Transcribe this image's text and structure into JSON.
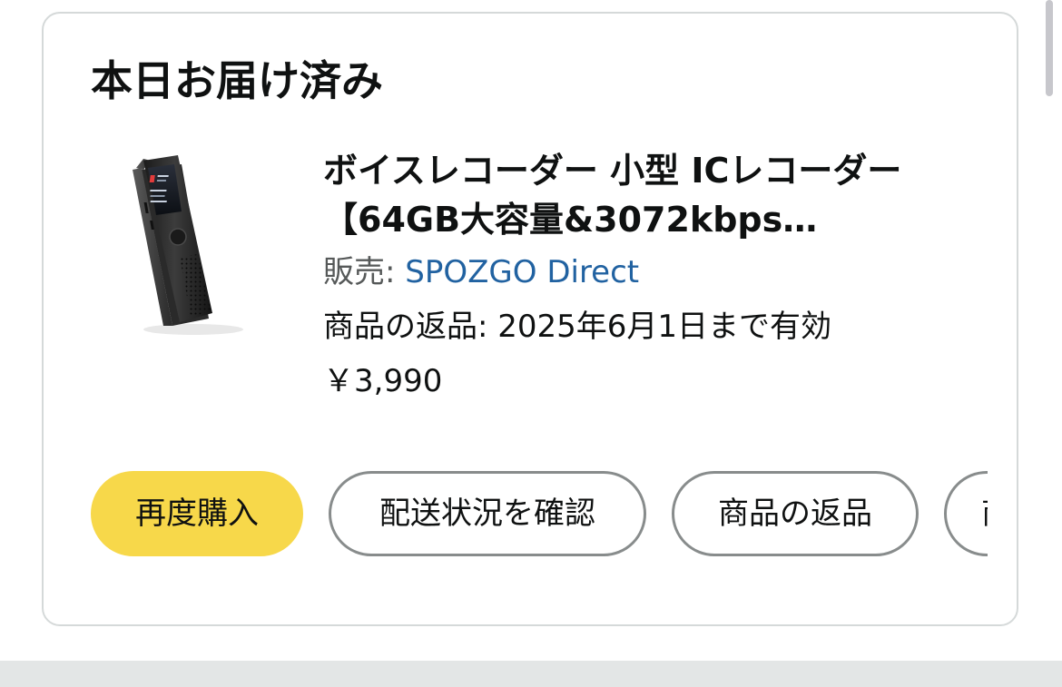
{
  "order_card": {
    "status_heading": "本日お届け済み",
    "product": {
      "title": "ボイスレコーダー 小型 ICレコーダー 【64GB大容量&3072kbps…",
      "seller_prefix": "販売: ",
      "seller_name": "SPOZGO Direct",
      "return_window": "商品の返品: 2025年6月1日まで有効",
      "price": "￥3,990",
      "image_icon": "voice-recorder-product-image"
    },
    "actions": {
      "buy_again": "再度購入",
      "track_package": "配送状況を確認",
      "return_item": "商品の返品",
      "more_partial": "商"
    }
  },
  "colors": {
    "buy_again_bg": "#f7d84a",
    "link": "#2162a1",
    "card_border": "#d5d9d9",
    "secondary_text": "#565959",
    "pill_border": "#888c8c",
    "bottom_band": "#e3e6e6"
  }
}
